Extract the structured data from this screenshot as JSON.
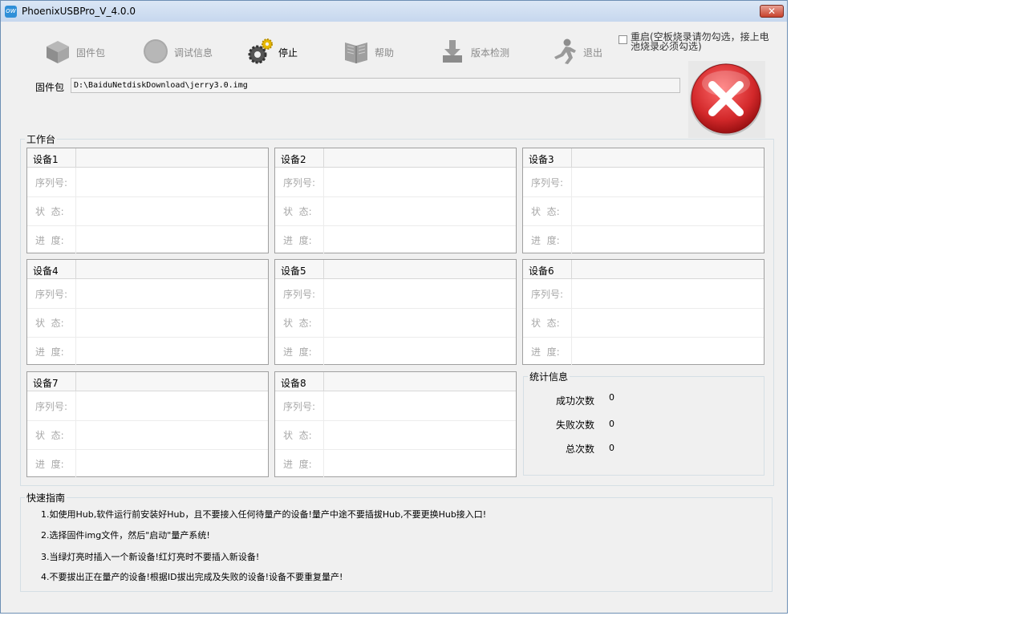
{
  "window": {
    "title": "PhoenixUSBPro_V_4.0.0",
    "close_label": "✕",
    "app_icon": "ow"
  },
  "toolbar": {
    "firmware": {
      "label": "固件包",
      "icon": "package-icon"
    },
    "debug": {
      "label": "调试信息",
      "icon": "circle-icon"
    },
    "stop": {
      "label": "停止",
      "icon": "gears-icon"
    },
    "help": {
      "label": "帮助",
      "icon": "book-icon"
    },
    "version": {
      "label": "版本检测",
      "icon": "download-icon"
    },
    "exit": {
      "label": "退出",
      "icon": "running-person-icon"
    }
  },
  "restart_option": {
    "label": "重启(空板烧录请勿勾选，接上电池烧录必须勾选)",
    "checked": false
  },
  "firmware_path": {
    "label": "固件包",
    "value": "D:\\BaiduNetdiskDownload\\jerry3.0.img"
  },
  "workbench": {
    "title": "工作台",
    "devices": [
      {
        "name": "设备1"
      },
      {
        "name": "设备2"
      },
      {
        "name": "设备3"
      },
      {
        "name": "设备4"
      },
      {
        "name": "设备5"
      },
      {
        "name": "设备6"
      },
      {
        "name": "设备7"
      },
      {
        "name": "设备8"
      }
    ],
    "field_labels": {
      "serial": "序列号:",
      "status": "状  态:",
      "progress": "进  度:"
    }
  },
  "stats": {
    "title": "统计信息",
    "success_label": "成功次数",
    "success_value": "0",
    "fail_label": "失败次数",
    "fail_value": "0",
    "total_label": "总次数",
    "total_value": "0"
  },
  "guide": {
    "title": "快速指南",
    "lines": [
      "1.如使用Hub,软件运行前安装好Hub，且不要接入任何待量产的设备!量产中途不要插拔Hub,不要更换Hub接入口!",
      "2.选择固件img文件，然后\"启动\"量产系统!",
      "3.当绿灯亮时插入一个新设备!红灯亮时不要插入新设备!",
      "4.不要拔出正在量产的设备!根据ID拔出完成及失败的设备!设备不要重复量产!"
    ]
  },
  "colors": {
    "accent_red": "#d2282a",
    "titlebar": "#c6d7ee",
    "window_bg": "#f0f0f0"
  }
}
